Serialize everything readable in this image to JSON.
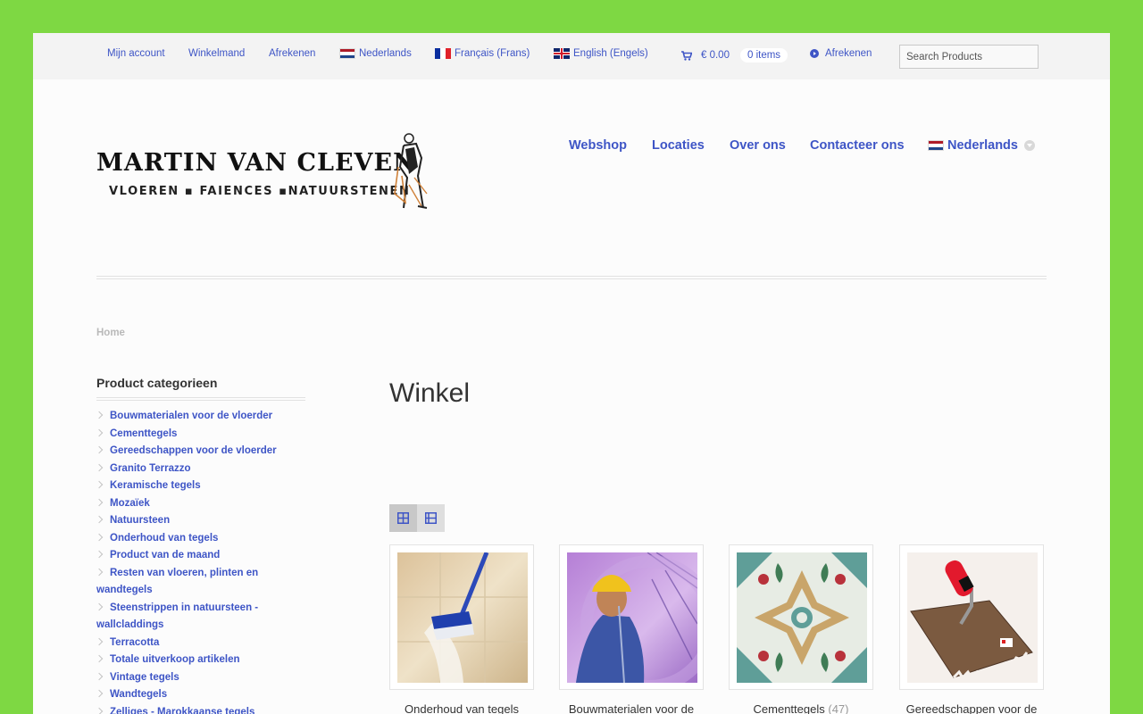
{
  "topbar": {
    "account": "Mijn account",
    "cart": "Winkelmand",
    "checkout": "Afrekenen",
    "languages": [
      {
        "label": "Nederlands",
        "flag": "nl"
      },
      {
        "label": "Français (Frans)",
        "flag": "fr"
      },
      {
        "label": "English (Engels)",
        "flag": "en"
      }
    ],
    "cart_total": "€ 0.00",
    "cart_items": "0 items",
    "checkout_link": "Afrekenen",
    "search_placeholder": "Search Products",
    "link_color": "#3e55c6"
  },
  "logo": {
    "title": "MARTIN VAN CLEVEN",
    "subtitle": "VLOEREN ▪ FAIENCES ▪NATUURSTENEN"
  },
  "nav": {
    "items": [
      "Webshop",
      "Locaties",
      "Over ons",
      "Contacteer ons"
    ],
    "language": "Nederlands"
  },
  "breadcrumb": "Home",
  "sidebar": {
    "title": "Product categorieen",
    "categories": [
      "Bouwmaterialen voor de vloerder",
      "Cementtegels",
      "Gereedschappen voor de vloerder",
      "Granito Terrazzo",
      "Keramische tegels",
      "Mozaïek",
      "Natuursteen",
      "Onderhoud van tegels",
      "Product van de maand",
      "Resten van vloeren, plinten en wandtegels",
      "Steenstrippen in natuursteen - wallcladdings",
      "Terracotta",
      "Totale uitverkoop artikelen",
      "Vintage tegels",
      "Wandtegels",
      "Zelliges - Marokkaanse tegels"
    ]
  },
  "main": {
    "title": "Winkel",
    "products": [
      {
        "name": "Onderhoud van tegels",
        "count": ""
      },
      {
        "name": "Bouwmaterialen voor de",
        "count": ""
      },
      {
        "name": "Cementtegels",
        "count": "(47)"
      },
      {
        "name": "Gereedschappen voor de",
        "count": ""
      }
    ]
  }
}
